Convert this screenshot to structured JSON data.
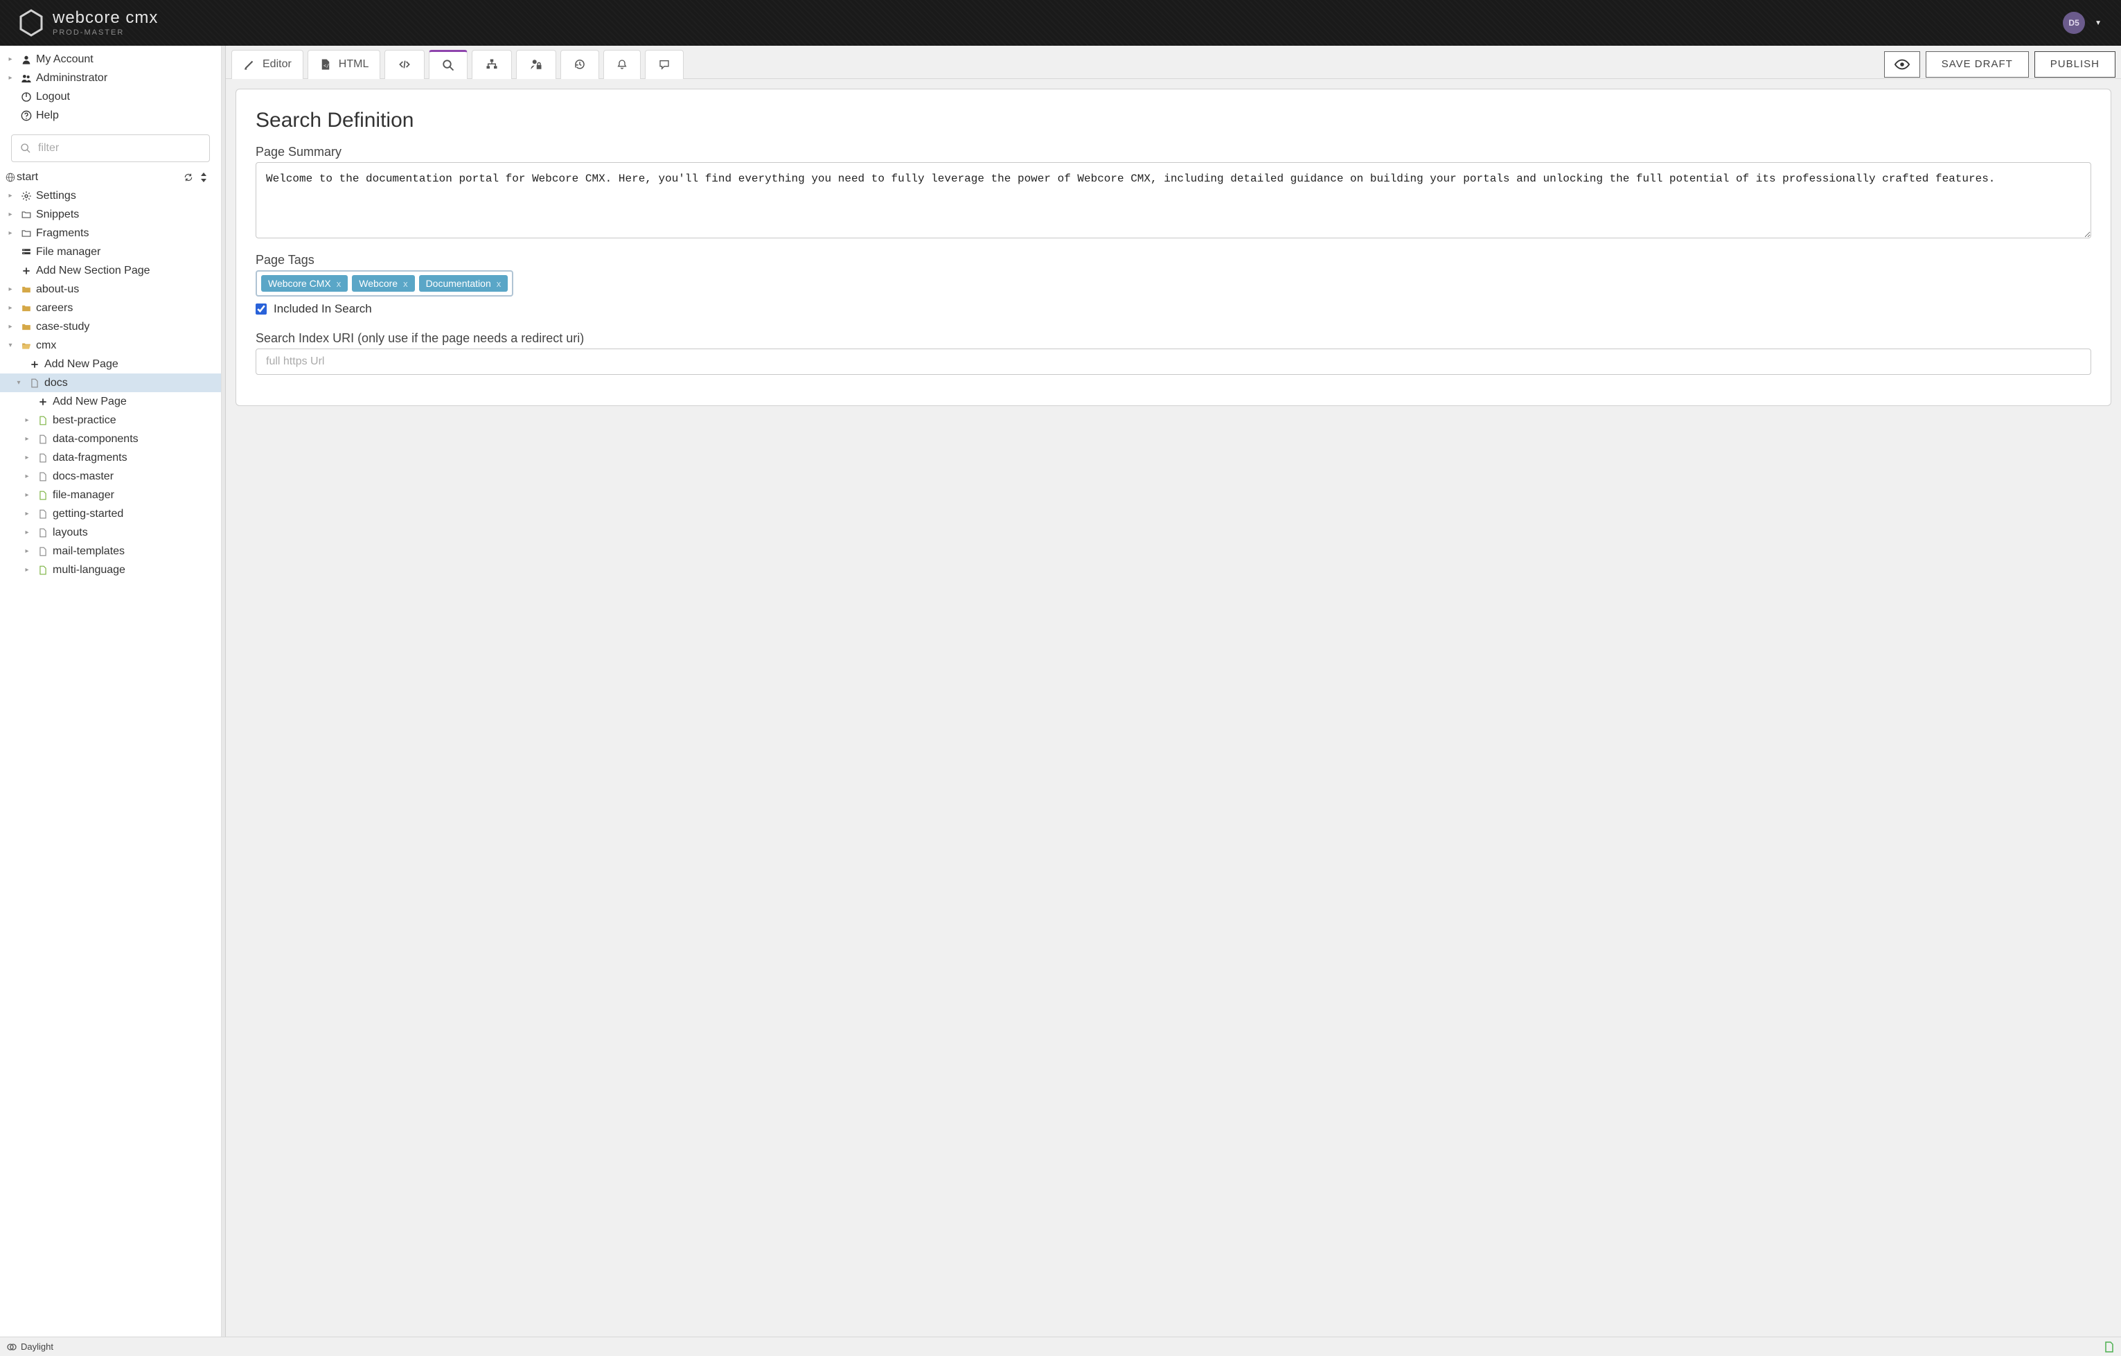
{
  "brand": {
    "title": "webcore cmx",
    "subtitle": "PROD-MASTER"
  },
  "avatar": {
    "initials": "D5"
  },
  "topMenu": [
    {
      "label": "My Account",
      "icon": "user"
    },
    {
      "label": "Admininstrator",
      "icon": "users"
    },
    {
      "label": "Logout",
      "icon": "power"
    },
    {
      "label": "Help",
      "icon": "help"
    }
  ],
  "filter": {
    "placeholder": "filter"
  },
  "startRow": {
    "label": "start"
  },
  "tree": [
    {
      "caret": true,
      "icon": "gear",
      "label": "Settings",
      "depth": 0
    },
    {
      "caret": true,
      "icon": "folder-o",
      "label": "Snippets",
      "depth": 0
    },
    {
      "caret": true,
      "icon": "folder-o",
      "label": "Fragments",
      "depth": 0
    },
    {
      "caret": false,
      "icon": "filemgr",
      "label": "File manager",
      "depth": 0
    },
    {
      "caret": false,
      "icon": "plus",
      "label": "Add New Section Page",
      "depth": 0
    },
    {
      "caret": true,
      "icon": "folder",
      "label": "about-us",
      "depth": 0
    },
    {
      "caret": true,
      "icon": "folder",
      "label": "careers",
      "depth": 0
    },
    {
      "caret": true,
      "icon": "folder",
      "label": "case-study",
      "depth": 0
    },
    {
      "caret": true,
      "open": true,
      "icon": "folder-open",
      "label": "cmx",
      "depth": 0
    },
    {
      "caret": false,
      "icon": "plus",
      "label": "Add New Page",
      "depth": 1
    },
    {
      "caret": true,
      "open": true,
      "icon": "file",
      "label": "docs",
      "depth": 1,
      "selected": true
    },
    {
      "caret": false,
      "icon": "plus",
      "label": "Add New Page",
      "depth": 2
    },
    {
      "caret": true,
      "icon": "file-g",
      "label": "best-practice",
      "depth": 2
    },
    {
      "caret": true,
      "icon": "file",
      "label": "data-components",
      "depth": 2
    },
    {
      "caret": true,
      "icon": "file",
      "label": "data-fragments",
      "depth": 2
    },
    {
      "caret": true,
      "icon": "file",
      "label": "docs-master",
      "depth": 2
    },
    {
      "caret": true,
      "icon": "file-g",
      "label": "file-manager",
      "depth": 2
    },
    {
      "caret": true,
      "icon": "file",
      "label": "getting-started",
      "depth": 2
    },
    {
      "caret": true,
      "icon": "file",
      "label": "layouts",
      "depth": 2
    },
    {
      "caret": true,
      "icon": "file",
      "label": "mail-templates",
      "depth": 2
    },
    {
      "caret": true,
      "icon": "file-g",
      "label": "multi-language",
      "depth": 2
    }
  ],
  "tabs": [
    {
      "label": "Editor",
      "icon": "edit"
    },
    {
      "label": "HTML",
      "icon": "code-file"
    },
    {
      "label": "",
      "icon": "code"
    },
    {
      "label": "",
      "icon": "search",
      "active": true
    },
    {
      "label": "",
      "icon": "sitemap"
    },
    {
      "label": "",
      "icon": "user-lock"
    },
    {
      "label": "",
      "icon": "history"
    },
    {
      "label": "",
      "icon": "bell"
    },
    {
      "label": "",
      "icon": "comment"
    }
  ],
  "actions": {
    "preview_icon": "eye",
    "save_draft": "SAVE DRAFT",
    "publish": "PUBLISH"
  },
  "panel": {
    "title": "Search Definition",
    "summary_label": "Page Summary",
    "summary_value": "Welcome to the documentation portal for Webcore CMX. Here, you'll find everything you need to fully leverage the power of Webcore CMX, including detailed guidance on building your portals and unlocking the full potential of its professionally crafted features.",
    "tags_label": "Page Tags",
    "tags": [
      "Webcore CMX",
      "Webcore",
      "Documentation"
    ],
    "included_label": "Included In Search",
    "included_checked": true,
    "uri_label": "Search Index URI (only use if the page needs a redirect uri)",
    "uri_placeholder": "full https Url"
  },
  "footer": {
    "theme": "Daylight"
  }
}
